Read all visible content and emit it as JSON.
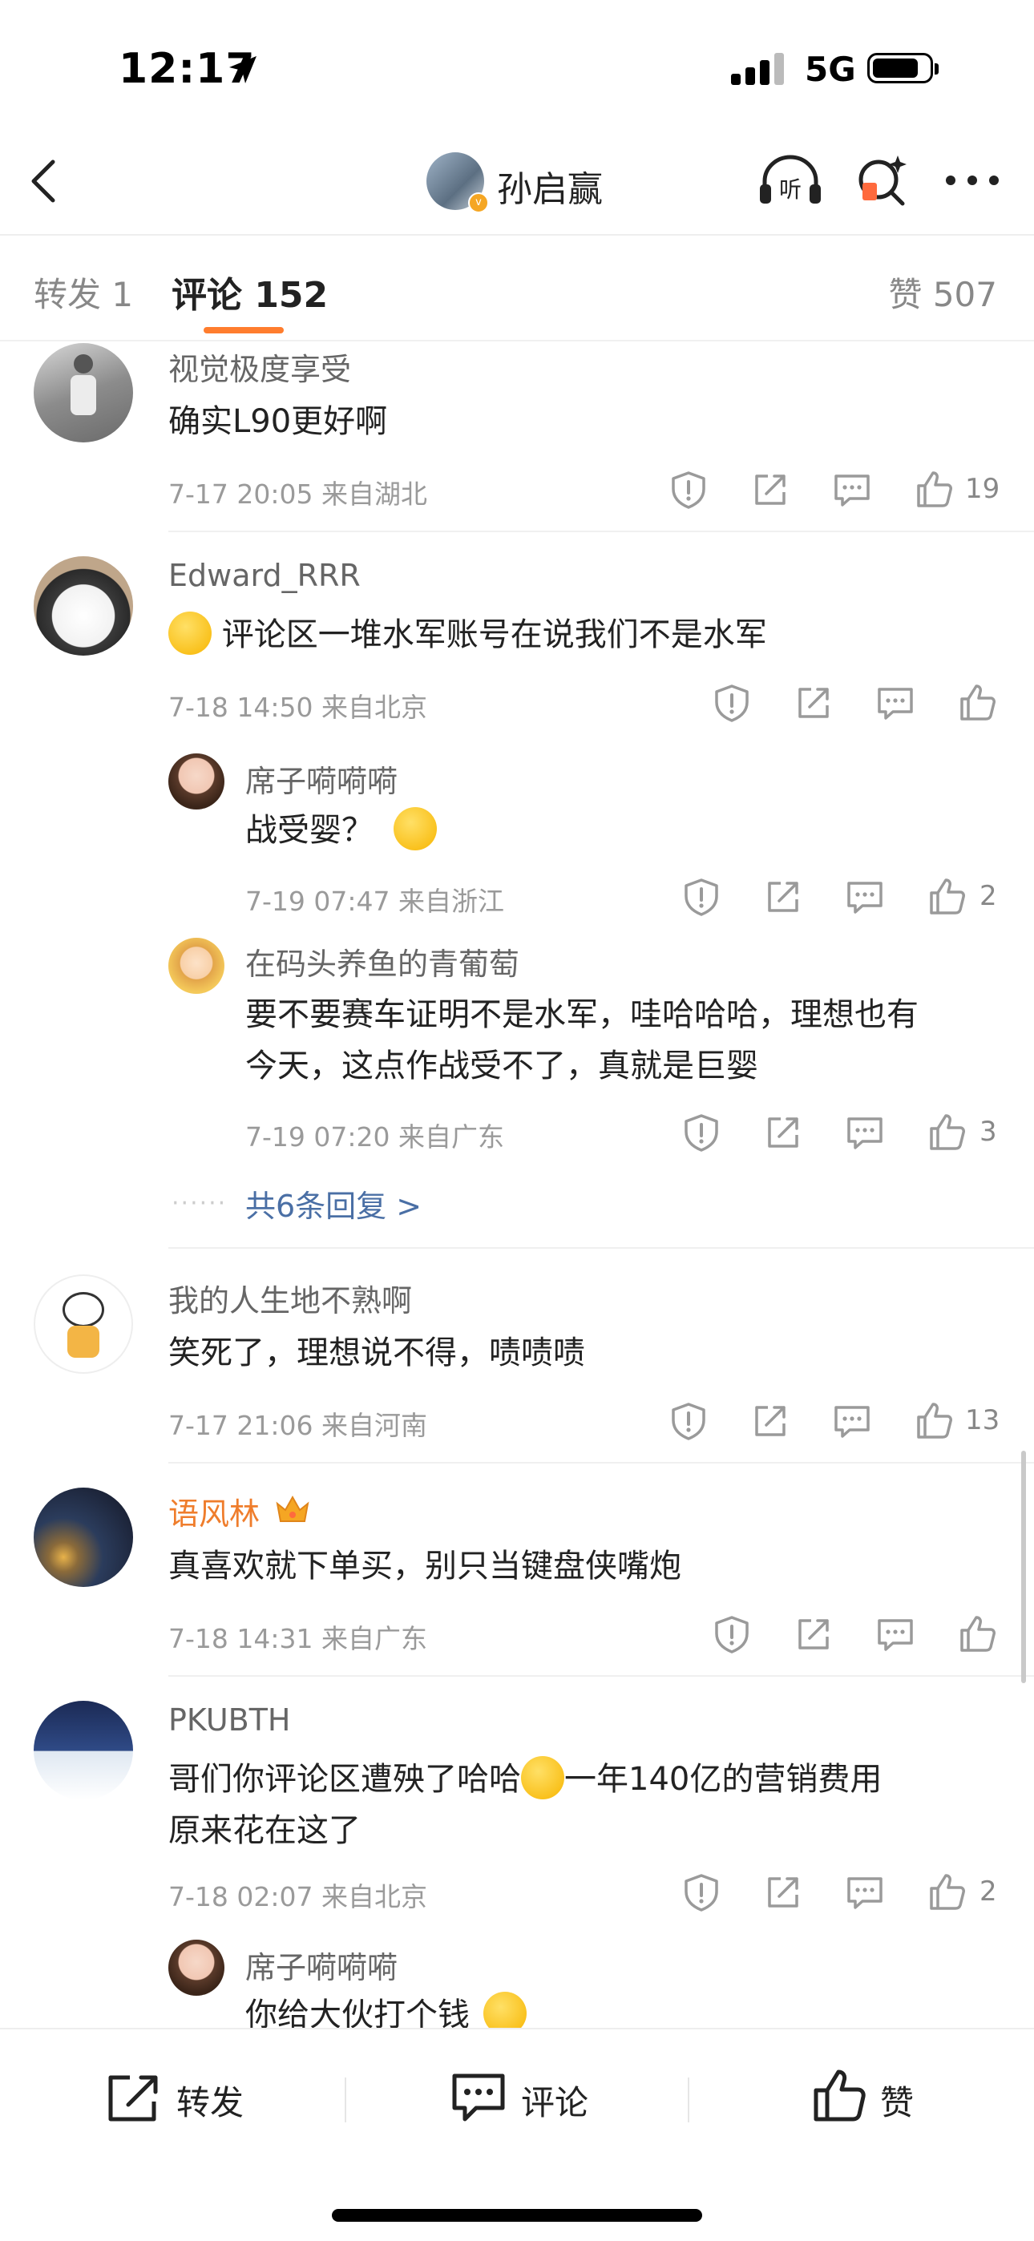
{
  "status_bar": {
    "time": "12:17",
    "network": "5G"
  },
  "header": {
    "name": "孙启赢",
    "listen_label": "听"
  },
  "tabs": {
    "forward": "转发 1",
    "comments": "评论 152",
    "likes": "赞 507"
  },
  "comments": [
    {
      "user": "视觉极度享受",
      "text": "确实L90更好啊",
      "meta": "7-17 20:05 来自湖北",
      "likes": "19"
    },
    {
      "user": "Edward_RRR",
      "text": "评论区一堆水军账号在说我们不是水军",
      "meta": "7-18 14:50 来自北京",
      "likes": "",
      "replies": [
        {
          "user": "席子嗬嗬嗬",
          "text": "战受婴？",
          "meta": "7-19 07:47 来自浙江",
          "likes": "2"
        },
        {
          "user": "在码头养鱼的青葡萄",
          "text_line1": "要不要赛车证明不是水军，哇哈哈哈，理想也有",
          "text_line2": "今天，这点作战受不了，真就是巨婴",
          "meta": "7-19 07:20 来自广东",
          "likes": "3"
        }
      ],
      "more_replies": "共6条回复 >"
    },
    {
      "user": "我的人生地不熟啊",
      "text": "笑死了，理想说不得，啧啧啧",
      "meta": "7-17 21:06 来自河南",
      "likes": "13"
    },
    {
      "user": "语风林",
      "text": "真喜欢就下单买，别只当键盘侠嘴炮",
      "meta": "7-18 14:31 来自广东",
      "likes": ""
    },
    {
      "user": "PKUBTH",
      "text_part1": "哥们你评论区遭殃了哈哈",
      "text_part2": "一年140亿的营销费用",
      "text_line2": "原来花在这了",
      "meta": "7-18 02:07 来自北京",
      "likes": "2",
      "replies": [
        {
          "user": "席子嗬嗬嗬",
          "text": "你给大伙打个钱"
        }
      ]
    }
  ],
  "bottom_bar": {
    "repost": "转发",
    "comment": "评论",
    "like": "赞"
  },
  "colors": {
    "accent": "#ff7d2e",
    "link": "#4a6fa5",
    "vip_name": "#ef7d2c"
  }
}
